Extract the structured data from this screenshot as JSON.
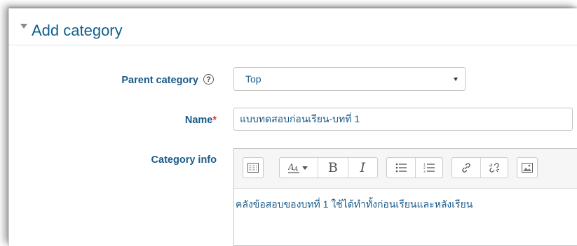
{
  "section": {
    "title": "Add category"
  },
  "form": {
    "parent_category": {
      "label": "Parent category",
      "value": "Top"
    },
    "name": {
      "label": "Name",
      "required_mark": "*",
      "value": "แบบทดสอบก่อนเรียน-บทที่ 1"
    },
    "category_info": {
      "label": "Category info",
      "content": "คลังข้อสอบของบทที่ 1 ใช้ได้ทำทั้งก่อนเรียนและหลังเรียน"
    }
  },
  "editor_toolbar": {
    "buttons": [
      "toolbar-toggle-icon",
      "font-color-icon",
      "bold-icon",
      "italic-icon",
      "unordered-list-icon",
      "ordered-list-icon",
      "link-icon",
      "unlink-icon",
      "image-icon"
    ],
    "bold_glyph": "B",
    "italic_glyph": "I"
  },
  "colors": {
    "label": "#1a5a89",
    "legend": "#0f5f8e",
    "required": "#d9352c"
  }
}
